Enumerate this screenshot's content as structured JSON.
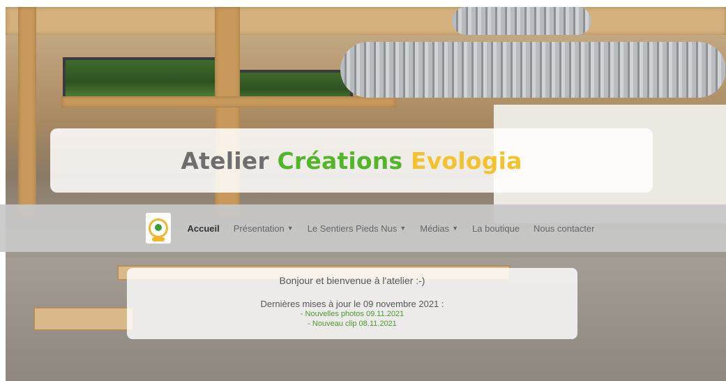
{
  "hero": {
    "title_part1": "Atelier",
    "title_part2": "Créations",
    "title_part3": "Evologia"
  },
  "navbar": {
    "items": [
      {
        "label": "Accueil",
        "active": true,
        "dropdown": false
      },
      {
        "label": "Présentation",
        "active": false,
        "dropdown": true
      },
      {
        "label": "Le Sentiers Pieds Nus",
        "active": false,
        "dropdown": true
      },
      {
        "label": "Médias",
        "active": false,
        "dropdown": true
      },
      {
        "label": "La boutique",
        "active": false,
        "dropdown": false
      },
      {
        "label": "Nous contacter",
        "active": false,
        "dropdown": false
      }
    ]
  },
  "welcome": {
    "greeting": "Bonjour et bienvenue à l'atelier :-)",
    "update_heading": "Dernières mises à jour le 09 novembre 2021 :",
    "links": [
      "- Nouvelles photos 09.11.2021",
      "- Nouveau clip 08.11.2021"
    ]
  },
  "colors": {
    "title_gray": "#6e6e6e",
    "title_green": "#52b52a",
    "title_yellow": "#f3c22c",
    "link_green": "#4a9a2a",
    "navbar_bg": "#c8c8c8"
  }
}
